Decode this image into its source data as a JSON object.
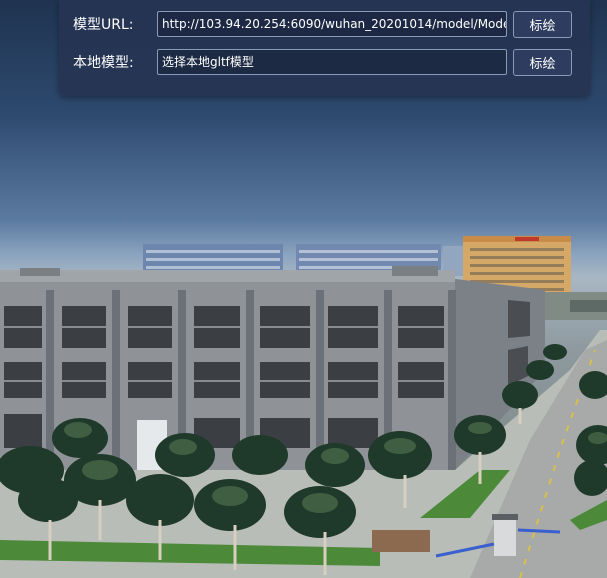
{
  "panel": {
    "url_row": {
      "label": "模型URL:",
      "value": "http://103.94.20.254:6090/wuhan_20201014/model/Model/",
      "button_label": "标绘"
    },
    "local_row": {
      "label": "本地模型:",
      "value": "选择本地gltf模型",
      "button_label": "标绘"
    }
  },
  "scene": {
    "sky_color": "#2e4a6f",
    "building_color": "#8d9196",
    "grass_color": "#4c8a3a",
    "road_color": "#a7aaa8",
    "accent_line_color": "#d8c04a",
    "highrise_accent": "#d9a25a"
  }
}
